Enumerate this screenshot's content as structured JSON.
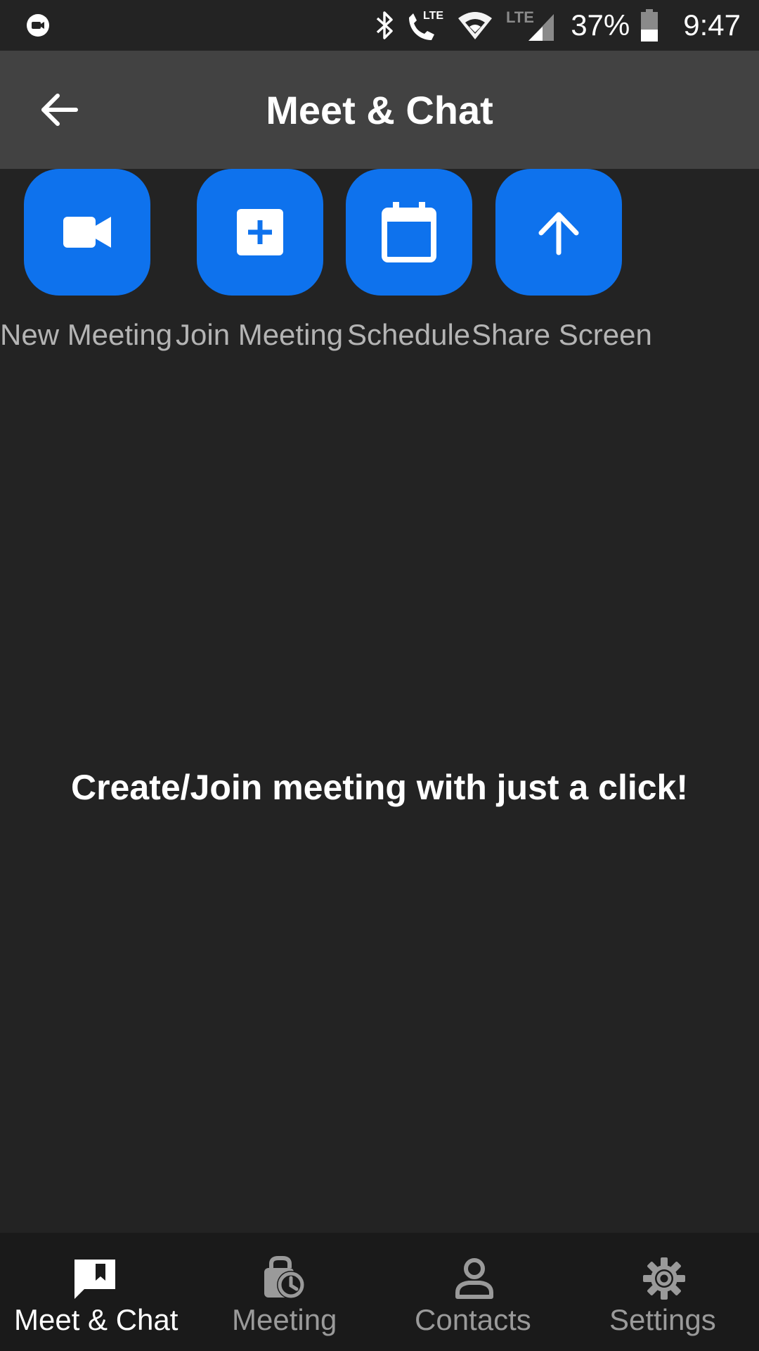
{
  "status_bar": {
    "battery_percent": "37%",
    "time": "9:47",
    "network_label": "LTE",
    "call_network_label": "LTE"
  },
  "app_bar": {
    "title": "Meet & Chat"
  },
  "actions": [
    {
      "label": "New Meeting",
      "icon": "video-camera-icon"
    },
    {
      "label": "Join Meeting",
      "icon": "plus-box-icon"
    },
    {
      "label": "Schedule",
      "icon": "calendar-icon"
    },
    {
      "label": "Share Screen",
      "icon": "arrow-up-icon"
    }
  ],
  "main": {
    "message": "Create/Join meeting with just a click!"
  },
  "bottom_nav": {
    "items": [
      {
        "label": "Meet & Chat",
        "icon": "chat-bubble-icon",
        "active": true
      },
      {
        "label": "Meeting",
        "icon": "clock-bag-icon",
        "active": false
      },
      {
        "label": "Contacts",
        "icon": "person-icon",
        "active": false
      },
      {
        "label": "Settings",
        "icon": "gear-icon",
        "active": false
      }
    ]
  },
  "colors": {
    "accent": "#0e72ed",
    "background": "#232323",
    "app_bar": "#424242",
    "bottom_nav": "#1a1a1a"
  }
}
